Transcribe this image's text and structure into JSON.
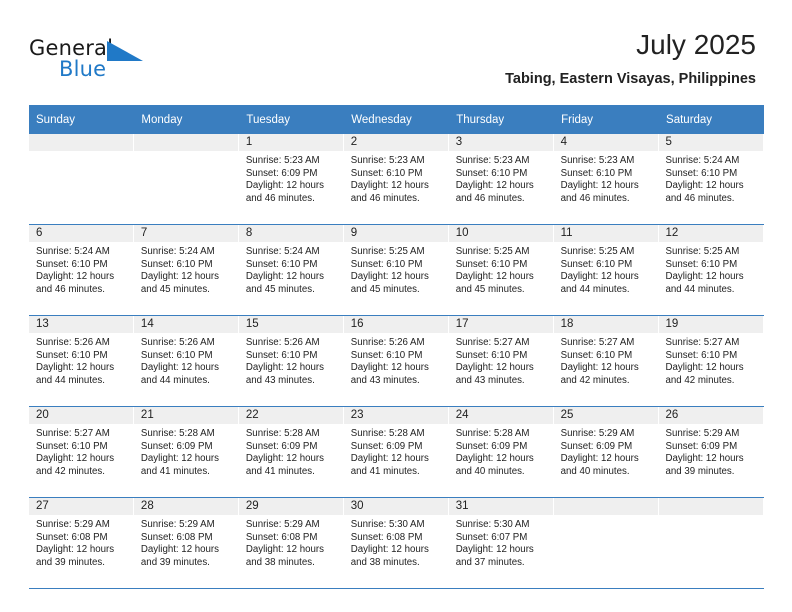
{
  "brand": {
    "name_top": "General",
    "name_bottom": "Blue",
    "accent_color": "#2079c7"
  },
  "header": {
    "title": "July 2025",
    "subtitle": "Tabing, Eastern Visayas, Philippines"
  },
  "theme": {
    "header_bg": "#3a7ebf",
    "header_text": "#ffffff",
    "daynum_bg": "#efefef",
    "cell_bg": "#ffffff",
    "text": "#222222"
  },
  "calendar": {
    "weekday_headers": [
      "Sunday",
      "Monday",
      "Tuesday",
      "Wednesday",
      "Thursday",
      "Friday",
      "Saturday"
    ],
    "labels": {
      "sunrise": "Sunrise:",
      "sunset": "Sunset:",
      "daylight": "Daylight:"
    },
    "weeks": [
      [
        {
          "day": "",
          "empty": true
        },
        {
          "day": "",
          "empty": true
        },
        {
          "day": "1",
          "sunrise": "Sunrise: 5:23 AM",
          "sunset": "Sunset: 6:09 PM",
          "daylight": "Daylight: 12 hours and 46 minutes."
        },
        {
          "day": "2",
          "sunrise": "Sunrise: 5:23 AM",
          "sunset": "Sunset: 6:10 PM",
          "daylight": "Daylight: 12 hours and 46 minutes."
        },
        {
          "day": "3",
          "sunrise": "Sunrise: 5:23 AM",
          "sunset": "Sunset: 6:10 PM",
          "daylight": "Daylight: 12 hours and 46 minutes."
        },
        {
          "day": "4",
          "sunrise": "Sunrise: 5:23 AM",
          "sunset": "Sunset: 6:10 PM",
          "daylight": "Daylight: 12 hours and 46 minutes."
        },
        {
          "day": "5",
          "sunrise": "Sunrise: 5:24 AM",
          "sunset": "Sunset: 6:10 PM",
          "daylight": "Daylight: 12 hours and 46 minutes."
        }
      ],
      [
        {
          "day": "6",
          "sunrise": "Sunrise: 5:24 AM",
          "sunset": "Sunset: 6:10 PM",
          "daylight": "Daylight: 12 hours and 46 minutes."
        },
        {
          "day": "7",
          "sunrise": "Sunrise: 5:24 AM",
          "sunset": "Sunset: 6:10 PM",
          "daylight": "Daylight: 12 hours and 45 minutes."
        },
        {
          "day": "8",
          "sunrise": "Sunrise: 5:24 AM",
          "sunset": "Sunset: 6:10 PM",
          "daylight": "Daylight: 12 hours and 45 minutes."
        },
        {
          "day": "9",
          "sunrise": "Sunrise: 5:25 AM",
          "sunset": "Sunset: 6:10 PM",
          "daylight": "Daylight: 12 hours and 45 minutes."
        },
        {
          "day": "10",
          "sunrise": "Sunrise: 5:25 AM",
          "sunset": "Sunset: 6:10 PM",
          "daylight": "Daylight: 12 hours and 45 minutes."
        },
        {
          "day": "11",
          "sunrise": "Sunrise: 5:25 AM",
          "sunset": "Sunset: 6:10 PM",
          "daylight": "Daylight: 12 hours and 44 minutes."
        },
        {
          "day": "12",
          "sunrise": "Sunrise: 5:25 AM",
          "sunset": "Sunset: 6:10 PM",
          "daylight": "Daylight: 12 hours and 44 minutes."
        }
      ],
      [
        {
          "day": "13",
          "sunrise": "Sunrise: 5:26 AM",
          "sunset": "Sunset: 6:10 PM",
          "daylight": "Daylight: 12 hours and 44 minutes."
        },
        {
          "day": "14",
          "sunrise": "Sunrise: 5:26 AM",
          "sunset": "Sunset: 6:10 PM",
          "daylight": "Daylight: 12 hours and 44 minutes."
        },
        {
          "day": "15",
          "sunrise": "Sunrise: 5:26 AM",
          "sunset": "Sunset: 6:10 PM",
          "daylight": "Daylight: 12 hours and 43 minutes."
        },
        {
          "day": "16",
          "sunrise": "Sunrise: 5:26 AM",
          "sunset": "Sunset: 6:10 PM",
          "daylight": "Daylight: 12 hours and 43 minutes."
        },
        {
          "day": "17",
          "sunrise": "Sunrise: 5:27 AM",
          "sunset": "Sunset: 6:10 PM",
          "daylight": "Daylight: 12 hours and 43 minutes."
        },
        {
          "day": "18",
          "sunrise": "Sunrise: 5:27 AM",
          "sunset": "Sunset: 6:10 PM",
          "daylight": "Daylight: 12 hours and 42 minutes."
        },
        {
          "day": "19",
          "sunrise": "Sunrise: 5:27 AM",
          "sunset": "Sunset: 6:10 PM",
          "daylight": "Daylight: 12 hours and 42 minutes."
        }
      ],
      [
        {
          "day": "20",
          "sunrise": "Sunrise: 5:27 AM",
          "sunset": "Sunset: 6:10 PM",
          "daylight": "Daylight: 12 hours and 42 minutes."
        },
        {
          "day": "21",
          "sunrise": "Sunrise: 5:28 AM",
          "sunset": "Sunset: 6:09 PM",
          "daylight": "Daylight: 12 hours and 41 minutes."
        },
        {
          "day": "22",
          "sunrise": "Sunrise: 5:28 AM",
          "sunset": "Sunset: 6:09 PM",
          "daylight": "Daylight: 12 hours and 41 minutes."
        },
        {
          "day": "23",
          "sunrise": "Sunrise: 5:28 AM",
          "sunset": "Sunset: 6:09 PM",
          "daylight": "Daylight: 12 hours and 41 minutes."
        },
        {
          "day": "24",
          "sunrise": "Sunrise: 5:28 AM",
          "sunset": "Sunset: 6:09 PM",
          "daylight": "Daylight: 12 hours and 40 minutes."
        },
        {
          "day": "25",
          "sunrise": "Sunrise: 5:29 AM",
          "sunset": "Sunset: 6:09 PM",
          "daylight": "Daylight: 12 hours and 40 minutes."
        },
        {
          "day": "26",
          "sunrise": "Sunrise: 5:29 AM",
          "sunset": "Sunset: 6:09 PM",
          "daylight": "Daylight: 12 hours and 39 minutes."
        }
      ],
      [
        {
          "day": "27",
          "sunrise": "Sunrise: 5:29 AM",
          "sunset": "Sunset: 6:08 PM",
          "daylight": "Daylight: 12 hours and 39 minutes."
        },
        {
          "day": "28",
          "sunrise": "Sunrise: 5:29 AM",
          "sunset": "Sunset: 6:08 PM",
          "daylight": "Daylight: 12 hours and 39 minutes."
        },
        {
          "day": "29",
          "sunrise": "Sunrise: 5:29 AM",
          "sunset": "Sunset: 6:08 PM",
          "daylight": "Daylight: 12 hours and 38 minutes."
        },
        {
          "day": "30",
          "sunrise": "Sunrise: 5:30 AM",
          "sunset": "Sunset: 6:08 PM",
          "daylight": "Daylight: 12 hours and 38 minutes."
        },
        {
          "day": "31",
          "sunrise": "Sunrise: 5:30 AM",
          "sunset": "Sunset: 6:07 PM",
          "daylight": "Daylight: 12 hours and 37 minutes."
        },
        {
          "day": "",
          "empty": true
        },
        {
          "day": "",
          "empty": true
        }
      ]
    ]
  }
}
